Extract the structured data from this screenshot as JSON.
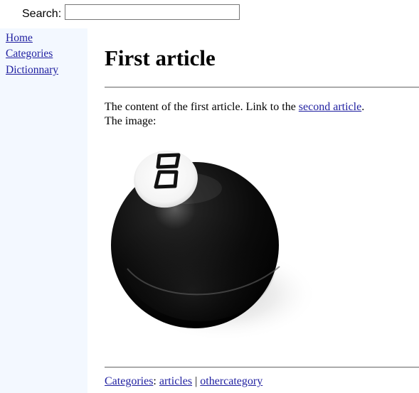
{
  "search": {
    "label": "Search:",
    "value": "",
    "placeholder": ""
  },
  "sidebar": {
    "links": [
      {
        "label": "Home"
      },
      {
        "label": "Categories"
      },
      {
        "label": "Dictionnary"
      }
    ]
  },
  "article": {
    "title": "First article",
    "content_text": "The content of the first article. Link to the ",
    "content_link": "second article",
    "content_suffix": ".",
    "image_label": "The image:",
    "image_icon": "eight-ball",
    "image_ball_number": "8"
  },
  "footer": {
    "categories_label": "Categories",
    "separator_colon": ":",
    "categories": [
      "articles",
      "othercategory"
    ],
    "separator": "|"
  },
  "colors": {
    "sidebar_bg": "#f3f8ff",
    "link": "#1f1fa0",
    "visited_link": "#551a8b"
  }
}
